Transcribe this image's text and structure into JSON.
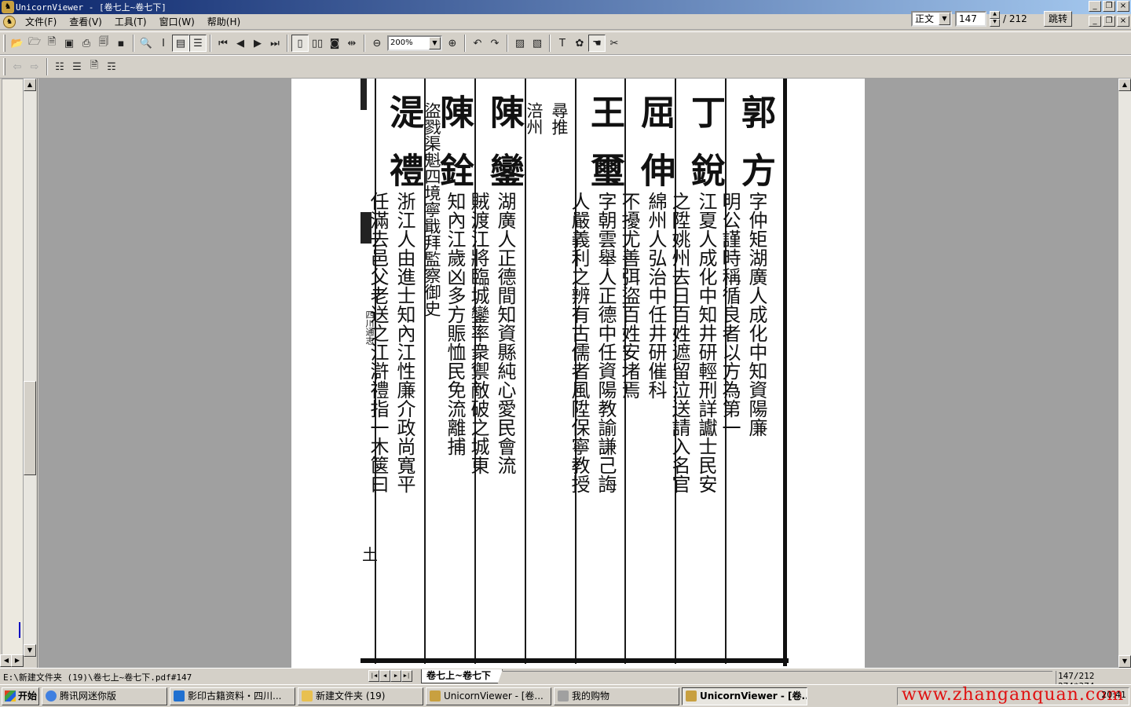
{
  "window": {
    "title": "UnicornViewer - [卷七上~卷七下]",
    "controls": [
      "_",
      "❐",
      "×"
    ]
  },
  "menu": {
    "items": [
      "文件(F)",
      "查看(V)",
      "工具(T)",
      "窗口(W)",
      "帮助(H)"
    ]
  },
  "nav": {
    "mode": "正文",
    "page": "147",
    "total": "/ 212",
    "go_label": "跳转"
  },
  "toolbar": {
    "zoom": "200%"
  },
  "document": {
    "margin_title": "四川通志",
    "page_mark": "土",
    "columns": [
      {
        "name": "郭方",
        "text": "字仲矩湖廣人成化中知資陽廉",
        "text2": "明公謹時稱循良者以方為第一"
      },
      {
        "name": "丁銳",
        "text": "江夏人成化中知井研輕刑詳讞士民安",
        "text2": "之陞姚州去日百姓遮留泣送請入名官"
      },
      {
        "name": "屈伸",
        "text": "綿州人弘治中任井研催科",
        "text2": "不擾尤善弭盜百姓安堵焉"
      },
      {
        "name": "王璽",
        "text": "字朝雲舉人正德中任資陽教諭謙己誨",
        "text2": "人嚴義利之辨有古儒者風陞保寧教授"
      },
      {
        "name": "",
        "text": "尋推",
        "text2": "涪州"
      },
      {
        "name": "陳鑾",
        "text": "湖廣人正德間知資縣純心愛民會流",
        "text2": "賊渡江將臨城鑾率衆禦敵破之城東"
      },
      {
        "name": "陳銓",
        "text": "",
        "text2": "知內江歲凶多方賑恤民免流離捕"
      },
      {
        "name": "",
        "text": "",
        "text2": "盜戮渠魁四境寧戢拜監察御史"
      },
      {
        "name": "湜禮",
        "text": "浙江人由進士知內江性廉介政尚寬平",
        "text2": "任滿去邑父老送之江滸禮指一木箧曰"
      }
    ]
  },
  "status": {
    "path": "E:\\新建文件夹 (19)\\卷七上~卷七下.pdf#147",
    "tab": "卷七上~卷七下",
    "page_info": "147/212 274*374"
  },
  "taskbar": {
    "start": "开始",
    "tasks": [
      "腾讯网迷你版",
      "影印古籍资料・四川...",
      "新建文件夹 (19)",
      "UnicornViewer - [卷...",
      "我的购物",
      "UnicornViewer - [卷..."
    ],
    "watermark": "www.zhanganquan.com",
    "clock": "20:41"
  },
  "colors": {
    "titlebar_start": "#0a246a",
    "titlebar_end": "#a6caf0",
    "chrome": "#d4d0c8",
    "viewer_bg": "#a0a0a0",
    "watermark": "#e01010"
  }
}
